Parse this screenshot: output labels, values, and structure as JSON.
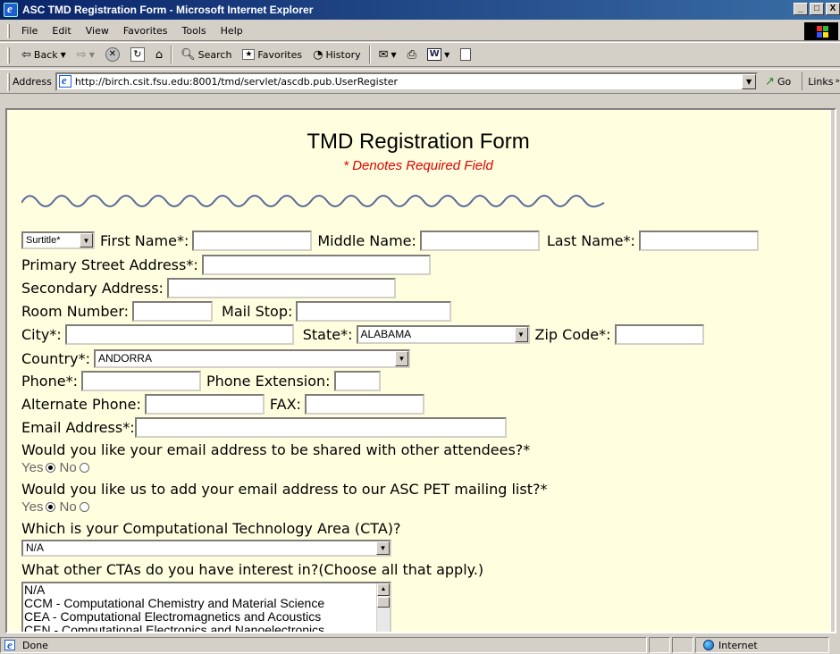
{
  "window": {
    "title": "ASC TMD Registration Form - Microsoft Internet Explorer",
    "controls": [
      "_",
      "□",
      "X"
    ]
  },
  "menubar": {
    "items": [
      "File",
      "Edit",
      "View",
      "Favorites",
      "Tools",
      "Help"
    ]
  },
  "toolbar": {
    "back": "Back",
    "search": "Search",
    "favorites": "Favorites",
    "history": "History"
  },
  "addressbar": {
    "label": "Address",
    "url": "http://birch.csit.fsu.edu:8001/tmd/servlet/ascdb.pub.UserRegister",
    "go": "Go",
    "links": "Links"
  },
  "form": {
    "title": "TMD Registration Form",
    "required_note": "* Denotes Required Field",
    "surtitle": {
      "value": "Surtitle*"
    },
    "first_name_label": "First Name*:",
    "middle_name_label": "Middle Name:",
    "last_name_label": "Last Name*:",
    "primary_address_label": "Primary Street Address*:",
    "secondary_address_label": "Secondary Address:",
    "room_number_label": "Room Number:",
    "mail_stop_label": "Mail Stop:",
    "city_label": "City*:",
    "state_label": "State*:",
    "state_value": "ALABAMA",
    "zip_label": "Zip Code*:",
    "country_label": "Country*:",
    "country_value": "ANDORRA",
    "phone_label": "Phone*:",
    "phone_ext_label": "Phone Extension:",
    "alt_phone_label": "Alternate Phone:",
    "fax_label": "FAX:",
    "email_label": "Email Address*:",
    "share_email_question": "Would you like your email address to be shared with other attendees?*",
    "share_email_yes": "Yes",
    "share_email_no": "No",
    "mailing_list_question": "Would you like us to add your email address to our ASC PET mailing list?*",
    "mailing_list_yes": "Yes",
    "mailing_list_no": "No",
    "cta_question": "Which is your Computational Technology Area (CTA)?",
    "cta_value": "N/A",
    "other_cta_question": "What other CTAs do you have interest in?(Choose all that apply.)",
    "other_cta_options": [
      "N/A",
      "CCM - Computational Chemistry and Material Science",
      "CEA - Computational Electromagnetics and Acoustics",
      "CEN - Computational Electronics and Nanoelectronics"
    ]
  },
  "statusbar": {
    "status": "Done",
    "zone": "Internet"
  }
}
